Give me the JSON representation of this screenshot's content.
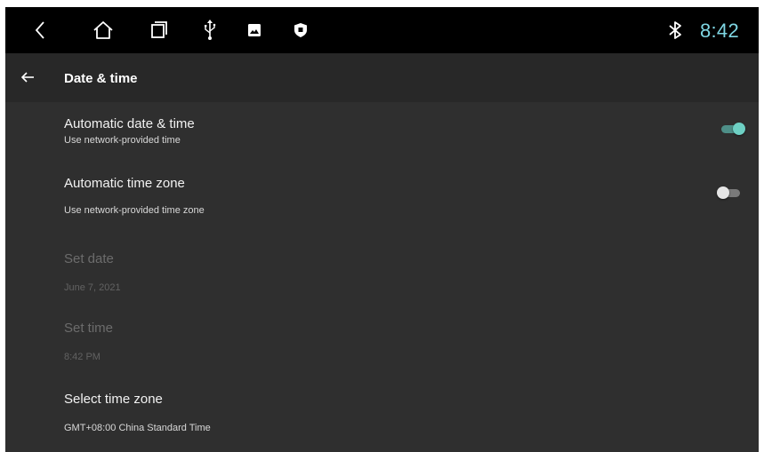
{
  "status_bar": {
    "time": "8:42",
    "icons": [
      "back-nav-icon",
      "home-icon",
      "recents-icon",
      "usb-icon",
      "image-icon",
      "shield-icon",
      "bluetooth-icon"
    ]
  },
  "app_bar": {
    "title": "Date & time",
    "back_icon": "arrow-left-icon"
  },
  "settings": {
    "auto_date_time": {
      "title": "Automatic date & time",
      "summary": "Use network-provided time",
      "enabled": true
    },
    "auto_time_zone": {
      "title": "Automatic time zone",
      "summary": "Use network-provided time zone",
      "enabled": false
    },
    "set_date": {
      "title": "Set date",
      "summary": "June 7, 2021",
      "disabled": true
    },
    "set_time": {
      "title": "Set time",
      "summary": "8:42 PM",
      "disabled": true
    },
    "time_zone": {
      "title": "Select time zone",
      "summary": "GMT+08:00 China Standard Time"
    }
  },
  "colors": {
    "accent": "#7fd6e3",
    "toggle_on_thumb": "#6ed0c4",
    "toggle_on_track": "#4e8f88",
    "toggle_off_thumb": "#e6e6e6",
    "toggle_off_track": "#7a7a7a",
    "background": "#2f2f2f"
  }
}
